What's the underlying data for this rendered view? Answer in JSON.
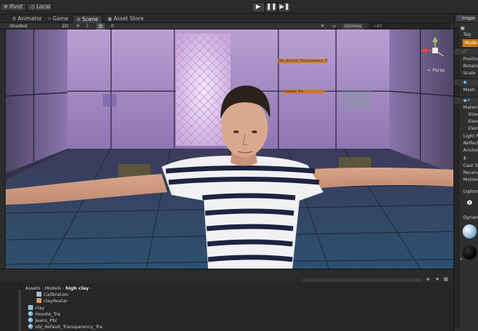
{
  "toolbar": {
    "pivot_label": "Pivot",
    "local_label": "Local",
    "play_icons": [
      "▶",
      "❚❚",
      "▶❚"
    ]
  },
  "tabs": [
    {
      "label": "Animator",
      "icon": "animator-icon"
    },
    {
      "label": "Game",
      "icon": "game-icon"
    },
    {
      "label": "Scene",
      "icon": "scene-icon",
      "active": true
    },
    {
      "label": "Asset Store",
      "icon": "asset-store-icon"
    }
  ],
  "scenebar": {
    "shading": "Shaded",
    "mode_2d": "2D",
    "fx_count": "0",
    "gizmos": "Gizmos",
    "search_placeholder": "All"
  },
  "viewport": {
    "label1": "obj_default_Transparency_Tra",
    "label2": "Hoodie_Tra",
    "persp": "< Persp"
  },
  "project": {
    "breadcrumb": [
      "Assets",
      "Models",
      "high clay"
    ],
    "items": [
      {
        "label": "Calibration",
        "icon": "file",
        "indent": 1
      },
      {
        "label": "clayAvatar",
        "icon": "avatar",
        "indent": 1
      },
      {
        "label": "clay",
        "icon": "model",
        "indent": 0
      },
      {
        "label": "Hoodie_Tra",
        "icon": "mesh",
        "indent": 0
      },
      {
        "label": "Jeans_Pbr",
        "icon": "mesh",
        "indent": 0
      },
      {
        "label": "obj_default_Transparency_Tra",
        "icon": "mesh",
        "indent": 0
      }
    ]
  },
  "inspector": {
    "tab": "Inspe",
    "tag": "Tag",
    "model": "Mode",
    "transform_rows": [
      "Positio",
      "Rotatio",
      "Scale"
    ],
    "mesh": "Mesh",
    "material_rows": [
      "Materi",
      "Size",
      "Elem",
      "Elem",
      "Light P",
      "Reflect",
      "Anchor"
    ],
    "render_rows": [
      "Cast S",
      "Receiv",
      "Motion"
    ],
    "lightmap": "Lightm",
    "dynamic": "Dynam"
  },
  "colors": {
    "accent_orange": "#c47a1c",
    "panel": "#2f2f2f",
    "wall": "#b49ad0",
    "floor": "#2d4a63"
  }
}
